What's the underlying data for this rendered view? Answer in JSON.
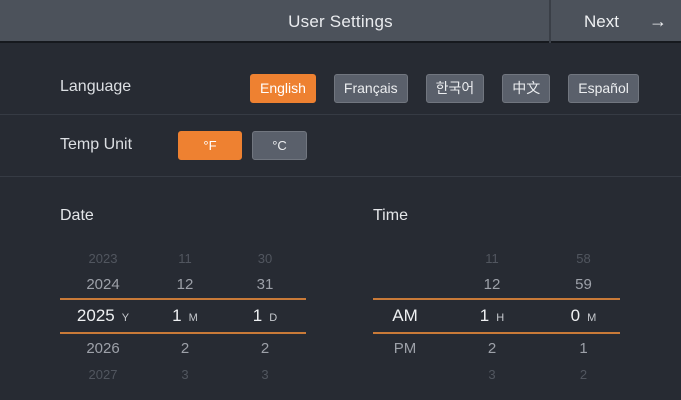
{
  "header": {
    "title": "User Settings",
    "next_label": "Next",
    "next_arrow": "→"
  },
  "language": {
    "label": "Language",
    "options": [
      {
        "name": "english",
        "label": "English",
        "selected": true
      },
      {
        "name": "francais",
        "label": "Français",
        "selected": false
      },
      {
        "name": "korean",
        "label": "한국어",
        "selected": false
      },
      {
        "name": "chinese",
        "label": "中文",
        "selected": false
      },
      {
        "name": "espanol",
        "label": "Español",
        "selected": false
      }
    ]
  },
  "temp_unit": {
    "label": "Temp Unit",
    "options": [
      {
        "name": "fahrenheit",
        "label": "°F",
        "selected": true
      },
      {
        "name": "celsius",
        "label": "°C",
        "selected": false
      }
    ]
  },
  "date_picker": {
    "title": "Date",
    "columns": [
      "year",
      "month",
      "day"
    ],
    "selected": {
      "year": "2025",
      "month": "1",
      "day": "1"
    },
    "rows": [
      [
        "2023",
        "11",
        "30"
      ],
      [
        "2024",
        "12",
        "31"
      ],
      [
        {
          "text": "2025",
          "suffix": "Y"
        },
        {
          "text": "1",
          "suffix": "M"
        },
        {
          "text": "1",
          "suffix": "D"
        }
      ],
      [
        "2026",
        "2",
        "2"
      ],
      [
        "2027",
        "3",
        "3"
      ]
    ]
  },
  "time_picker": {
    "title": "Time",
    "columns": [
      "meridiem",
      "hour",
      "minute"
    ],
    "selected": {
      "meridiem": "AM",
      "hour": "1",
      "minute": "0"
    },
    "rows": [
      [
        "",
        "11",
        "58"
      ],
      [
        "",
        "12",
        "59"
      ],
      [
        {
          "text": "AM"
        },
        {
          "text": "1",
          "suffix": "H"
        },
        {
          "text": "0",
          "suffix": "M"
        }
      ],
      [
        "PM",
        "2",
        "1"
      ],
      [
        "",
        "3",
        "2"
      ]
    ]
  },
  "colors": {
    "accent_orange": "#ee8131",
    "wheel_line_orange": "#c97a38",
    "header_bg": "#4c525b",
    "screen_bg": "#272b33",
    "button_grey": "#5a606b"
  }
}
